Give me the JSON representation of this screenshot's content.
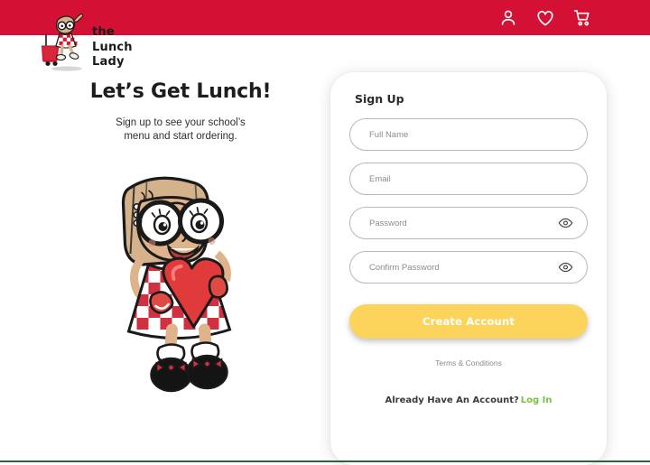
{
  "brand": {
    "logo_line1": "the",
    "logo_line2": "Lunch",
    "logo_line3": "Lady",
    "header_color": "#d41134",
    "accent_yellow": "#fcd45c",
    "accent_green": "#7cc142",
    "footer_line_color": "#35603f"
  },
  "header": {
    "icons": [
      {
        "name": "account-icon",
        "label": "Account"
      },
      {
        "name": "favorites-icon",
        "label": "Favorites"
      },
      {
        "name": "cart-icon",
        "label": "Cart"
      }
    ]
  },
  "left_panel": {
    "headline": "Let’s Get Lunch!",
    "subhead_line1": "Sign up to see your school’s",
    "subhead_line2": "menu and start ordering.",
    "illustration_name": "lunch-lady-holding-heart"
  },
  "signup_card": {
    "title": "Sign Up",
    "fields": [
      {
        "name": "full-name-field",
        "placeholder": "Full Name",
        "value": "",
        "type": "text",
        "has_eye": false
      },
      {
        "name": "email-field",
        "placeholder": "Email",
        "value": "",
        "type": "text",
        "has_eye": false
      },
      {
        "name": "password-field",
        "placeholder": "Password",
        "value": "",
        "type": "password",
        "has_eye": true
      },
      {
        "name": "confirm-password-field",
        "placeholder": "Confirm Password",
        "value": "",
        "type": "password",
        "has_eye": true
      }
    ],
    "submit_label": "Create Account",
    "terms_label": "Terms & Conditions",
    "account_prompt": "Already Have An Account?",
    "login_label": "Log In"
  }
}
